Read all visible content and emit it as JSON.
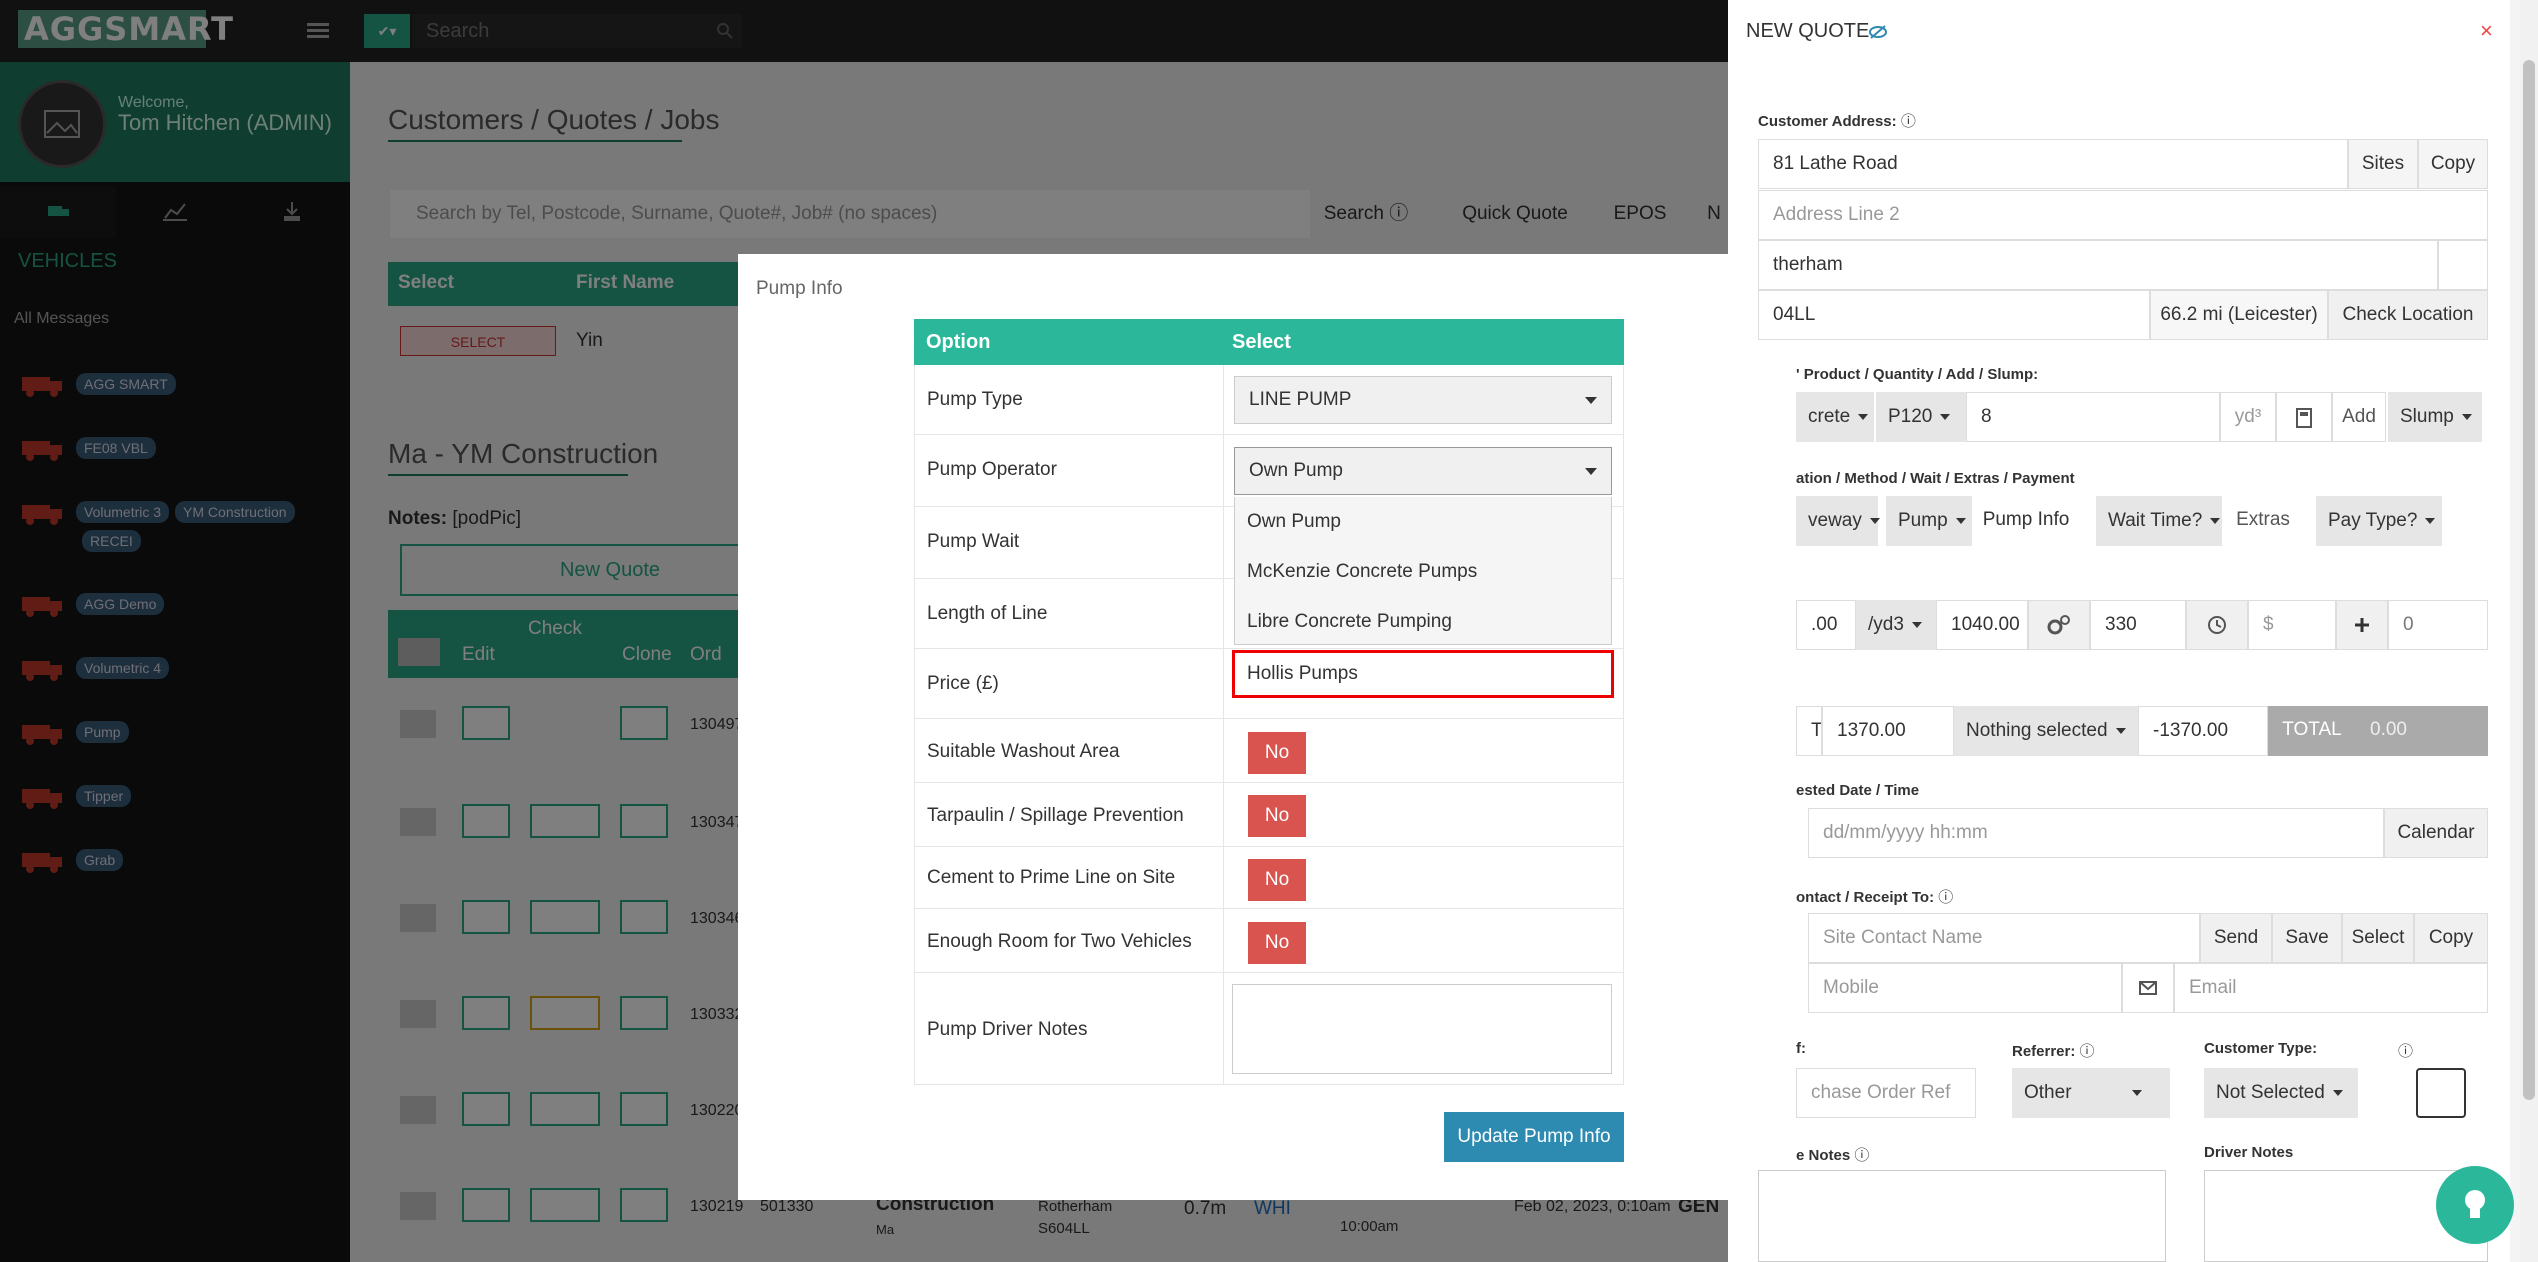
{
  "topbar": {
    "logo": "AGGSMART",
    "search_placeholder": "Search"
  },
  "sidebar": {
    "welcome": "Welcome,",
    "username": "Tom Hitchen (ADMIN)",
    "vehicles_heading": "VEHICLES",
    "all_messages": "All Messages",
    "vehicles": [
      {
        "badges": [
          "AGG SMART"
        ]
      },
      {
        "badges": [
          "FE08 VBL"
        ]
      },
      {
        "badges": [
          "Volumetric 3",
          "YM Construction",
          "RECEI"
        ]
      },
      {
        "badges": [
          "AGG Demo"
        ]
      },
      {
        "badges": [
          "Volumetric 4"
        ]
      },
      {
        "badges": [
          "Pump"
        ]
      },
      {
        "badges": [
          "Tipper"
        ]
      },
      {
        "badges": [
          "Grab"
        ]
      }
    ]
  },
  "main": {
    "breadcrumb": "Customers / Quotes / Jobs",
    "search_placeholder": "Search by Tel, Postcode, Surname, Quote#, Job# (no spaces)",
    "buttons": {
      "search": "Search",
      "quick_quote": "Quick Quote",
      "epos": "EPOS",
      "more": "N"
    },
    "customer_headers": {
      "select": "Select",
      "first_name": "First Name"
    },
    "customer_row": {
      "select_btn": "SELECT",
      "first_name": "Yin"
    },
    "section_title": "Ma - YM Construction",
    "notes_label": "Notes:",
    "notes_value": "[podPic]",
    "new_quote": "New Quote",
    "jobs_headers": {
      "edit": "Edit",
      "check": "Check",
      "clone": "Clone",
      "ord": "Ord"
    },
    "jobs": [
      {
        "ord": "130497"
      },
      {
        "ord": "130347"
      },
      {
        "ord": "130346"
      },
      {
        "ord": "130332"
      },
      {
        "ord": "130220"
      },
      {
        "ord": "130219",
        "num": "501330",
        "customer": "Construction",
        "customer_sub": "Ma",
        "city": "Rotherham",
        "postcode": "S604LL",
        "dist": "0.7m",
        "code": "WHI",
        "time": "10:00am",
        "date": "Feb 02, 2023, 0:10am",
        "status": "GEN"
      }
    ]
  },
  "modal": {
    "title": "Pump Info",
    "close": "×",
    "headers": {
      "option": "Option",
      "select": "Select"
    },
    "rows": {
      "pump_type": {
        "label": "Pump Type",
        "value": "LINE PUMP"
      },
      "pump_operator": {
        "label": "Pump Operator",
        "value": "Own Pump"
      },
      "pump_wait": {
        "label": "Pump Wait"
      },
      "length_of_line": {
        "label": "Length of Line"
      },
      "price": {
        "label": "Price (£)"
      },
      "washout": {
        "label": "Suitable Washout Area",
        "value": "No"
      },
      "tarpaulin": {
        "label": "Tarpaulin / Spillage Prevention",
        "value": "No"
      },
      "cement": {
        "label": "Cement to Prime Line on Site",
        "value": "No"
      },
      "room": {
        "label": "Enough Room for Two Vehicles",
        "value": "No"
      },
      "driver_notes": {
        "label": "Pump Driver Notes"
      }
    },
    "operator_options": [
      "Own Pump",
      "McKenzie Concrete Pumps",
      "Libre Concrete Pumping",
      "Hollis Pumps"
    ],
    "update_button": "Update Pump Info",
    "colors": {
      "header": "#2bb89a",
      "no_button": "#d9534f",
      "update_button": "#2d8ab0",
      "highlight": "#e00000"
    }
  },
  "quote_panel": {
    "title": "NEW QUOTE",
    "close": "×",
    "customer_address_label": "Customer Address:",
    "address_line1": "81 Lathe Road",
    "sites": "Sites",
    "copy": "Copy",
    "address_line2_placeholder": "Address Line 2",
    "city": "therham",
    "postcode": "04LL",
    "distance": "66.2 mi (Leicester)",
    "check_location": "Check Location",
    "product_label": "' Product / Quantity / Add / Slump:",
    "product": "crete",
    "product_code": "P120",
    "quantity": "8",
    "unit": "yd³",
    "add": "Add",
    "slump": "Slump",
    "method_label": "ation / Method / Wait / Extras / Payment",
    "location": "veway",
    "method": "Pump",
    "pump_info": "Pump Info",
    "wait_time": "Wait Time?",
    "extras": "Extras",
    "pay_type": "Pay Type?",
    "price_partial": ".00",
    "price_unit": "/yd3",
    "price_total": "1040.00",
    "qty_330": "330",
    "currency_placeholder": "$",
    "zero": "0",
    "vat_partial": "T",
    "vat_amount": "1370.00",
    "nothing_selected": "Nothing selected",
    "discount": "-1370.00",
    "total_label": "TOTAL",
    "total_value": "0.00",
    "date_label": "ested Date / Time",
    "date_placeholder": "dd/mm/yyyy hh:mm",
    "calendar": "Calendar",
    "contact_label": "ontact / Receipt To:",
    "contact_placeholder": "Site Contact Name",
    "send": "Send",
    "save": "Save",
    "select": "Select",
    "copy2": "Copy",
    "mobile_placeholder": "Mobile",
    "email_placeholder": "Email",
    "ref_label": "f:",
    "referrer_label": "Referrer:",
    "customer_type_label": "Customer Type:",
    "po_placeholder": "chase Order Ref",
    "referrer_value": "Other",
    "customer_type_value": "Not Selected",
    "notes_label": "e Notes",
    "driver_notes_label": "Driver Notes"
  }
}
